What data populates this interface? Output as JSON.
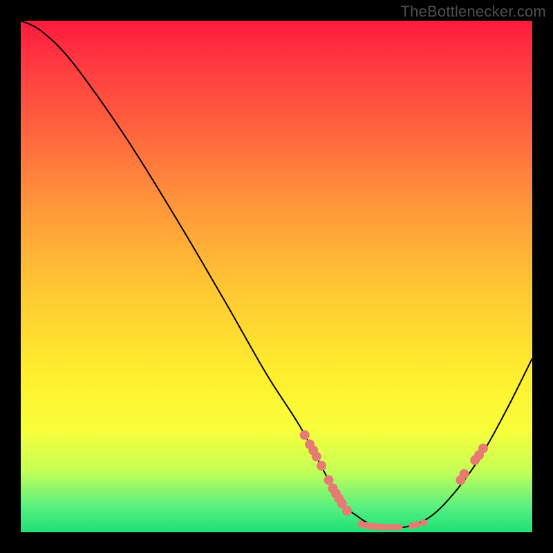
{
  "watermark": "TheBottlenecker.com",
  "chart_data": {
    "type": "line",
    "title": "",
    "xlabel": "",
    "ylabel": "",
    "xlim": [
      0,
      100
    ],
    "ylim": [
      0,
      100
    ],
    "curve": {
      "x": [
        0,
        4,
        10,
        20,
        30,
        40,
        48,
        55,
        62,
        66,
        70,
        75,
        80,
        85,
        90,
        95,
        100
      ],
      "y": [
        100,
        98,
        92,
        78,
        62,
        45,
        31,
        20,
        7,
        3,
        1,
        1,
        3,
        8,
        15,
        24,
        34
      ]
    },
    "left_marker_cluster": {
      "x": [
        55.5,
        56.5,
        57.2,
        57.8,
        58.8,
        60.2,
        61.0,
        61.6,
        62.2,
        62.8,
        63.8
      ],
      "y": [
        19.0,
        17.2,
        16.0,
        14.8,
        13.0,
        10.2,
        8.6,
        7.6,
        6.6,
        5.6,
        4.2
      ]
    },
    "bottom_marker_cluster": {
      "x": [
        66.5,
        67.5,
        68.0,
        68.8,
        69.5,
        70.3,
        71.0,
        72.0,
        73.0,
        74.0,
        76.5,
        77.5,
        78.8
      ],
      "y": [
        1.6,
        1.35,
        1.25,
        1.15,
        1.1,
        1.05,
        1.0,
        0.98,
        0.98,
        1.0,
        1.3,
        1.5,
        1.9
      ]
    },
    "right_marker_cluster": {
      "x": [
        86.0,
        86.7,
        88.8,
        89.6,
        90.4
      ],
      "y": [
        10.2,
        11.4,
        14.1,
        15.1,
        16.4
      ]
    },
    "marker_color": "#e77a72",
    "marker_radius_small": 5,
    "marker_radius_large": 7,
    "curve_color": "#000000",
    "curve_width": 2
  }
}
